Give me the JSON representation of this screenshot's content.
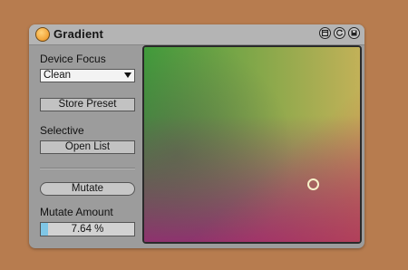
{
  "device": {
    "title": "Gradient",
    "title_icons": [
      "window-icon",
      "reset-icon",
      "save-icon"
    ]
  },
  "controls": {
    "device_focus_label": "Device Focus",
    "device_focus_value": "Clean",
    "store_preset_label": "Store Preset",
    "selective_label": "Selective",
    "open_list_label": "Open List",
    "mutate_label": "Mutate",
    "mutate_amount_label": "Mutate Amount",
    "mutate_amount_value": "7.64 %",
    "mutate_amount_fraction": 0.0764
  },
  "xy_pad": {
    "cursor_x": 0.78,
    "cursor_y": 0.7
  },
  "colors": {
    "background": "#b77c4f",
    "panel": "#9c9c9c",
    "power_on": "#f3a63a",
    "slider_fill": "#7fc6e6",
    "cursor_ring": "#f7f1c9"
  }
}
